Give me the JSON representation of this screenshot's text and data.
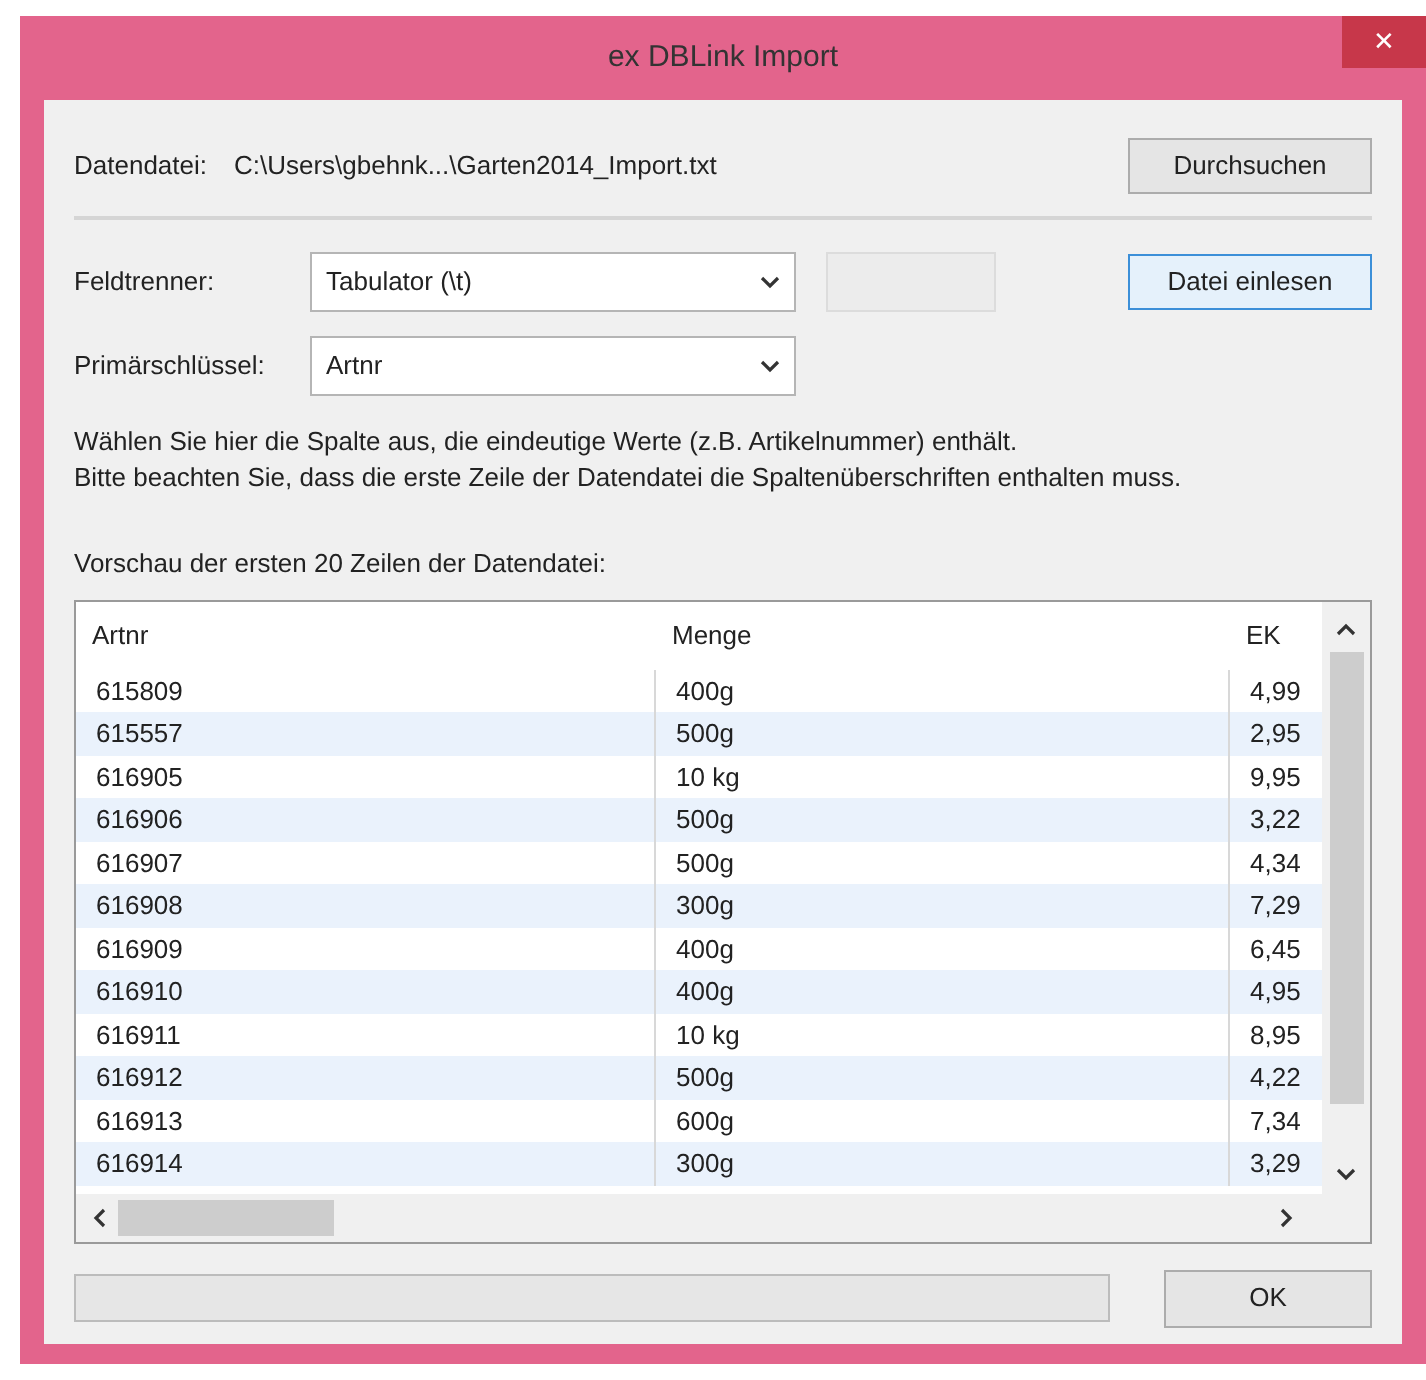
{
  "window": {
    "title": "ex DBLink Import",
    "close": "✕"
  },
  "file": {
    "label": "Datendatei:",
    "path": "C:\\Users\\gbehnk...\\Garten2014_Import.txt",
    "browse": "Durchsuchen"
  },
  "separator_field": {
    "label": "Feldtrenner:",
    "value": "Tabulator (\\t)",
    "read": "Datei einlesen"
  },
  "primary_key": {
    "label": "Primärschlüssel:",
    "value": "Artnr"
  },
  "hints": [
    "Wählen Sie hier die Spalte aus, die eindeutige Werte (z.B. Artikelnummer) enthält.",
    "Bitte beachten Sie, dass die erste Zeile der Datendatei die Spaltenüberschriften enthalten muss."
  ],
  "preview_label": "Vorschau der ersten 20 Zeilen der Datendatei:",
  "table": {
    "columns": [
      "Artnr",
      "Menge",
      "EK"
    ],
    "rows": [
      [
        "615809",
        "400g",
        "4,99"
      ],
      [
        "615557",
        "500g",
        "2,95"
      ],
      [
        "616905",
        "10 kg",
        "9,95"
      ],
      [
        "616906",
        "500g",
        "3,22"
      ],
      [
        "616907",
        "500g",
        "4,34"
      ],
      [
        "616908",
        "300g",
        "7,29"
      ],
      [
        "616909",
        "400g",
        "6,45"
      ],
      [
        "616910",
        "400g",
        "4,95"
      ],
      [
        "616911",
        "10 kg",
        "8,95"
      ],
      [
        "616912",
        "500g",
        "4,22"
      ],
      [
        "616913",
        "600g",
        "7,34"
      ],
      [
        "616914",
        "300g",
        "3,29"
      ]
    ]
  },
  "progress": {
    "level": 0
  },
  "ok": "OK"
}
